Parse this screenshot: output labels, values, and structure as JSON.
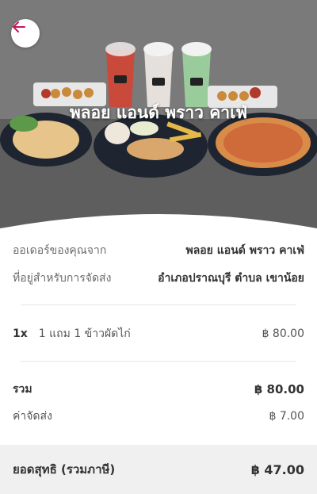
{
  "store": {
    "name": "พลอย แอนด์ พราว คาเฟ่"
  },
  "order": {
    "from_label": "ออเดอร์ของคุณจาก",
    "from_value": "พลอย แอนด์ พราว คาเฟ่",
    "address_label": "ที่อยู่สำหรับการจัดส่ง",
    "address_value": "อำเภอปราณบุรี ตำบล เขาน้อย"
  },
  "items": [
    {
      "qty": "1x",
      "name": "1 แถม 1 ข้าวผัดไก่",
      "price": "฿ 80.00"
    }
  ],
  "summary": {
    "subtotal_label": "รวม",
    "subtotal_value": "฿ 80.00",
    "delivery_label": "ค่าจัดส่ง",
    "delivery_value": "฿ 7.00",
    "net_label": "ยอดสุทธิ (รวมภาษี)",
    "net_value": "฿ 47.00"
  },
  "colors": {
    "accent": "#c2185b"
  },
  "icons": {
    "back": "arrow-left-icon"
  }
}
